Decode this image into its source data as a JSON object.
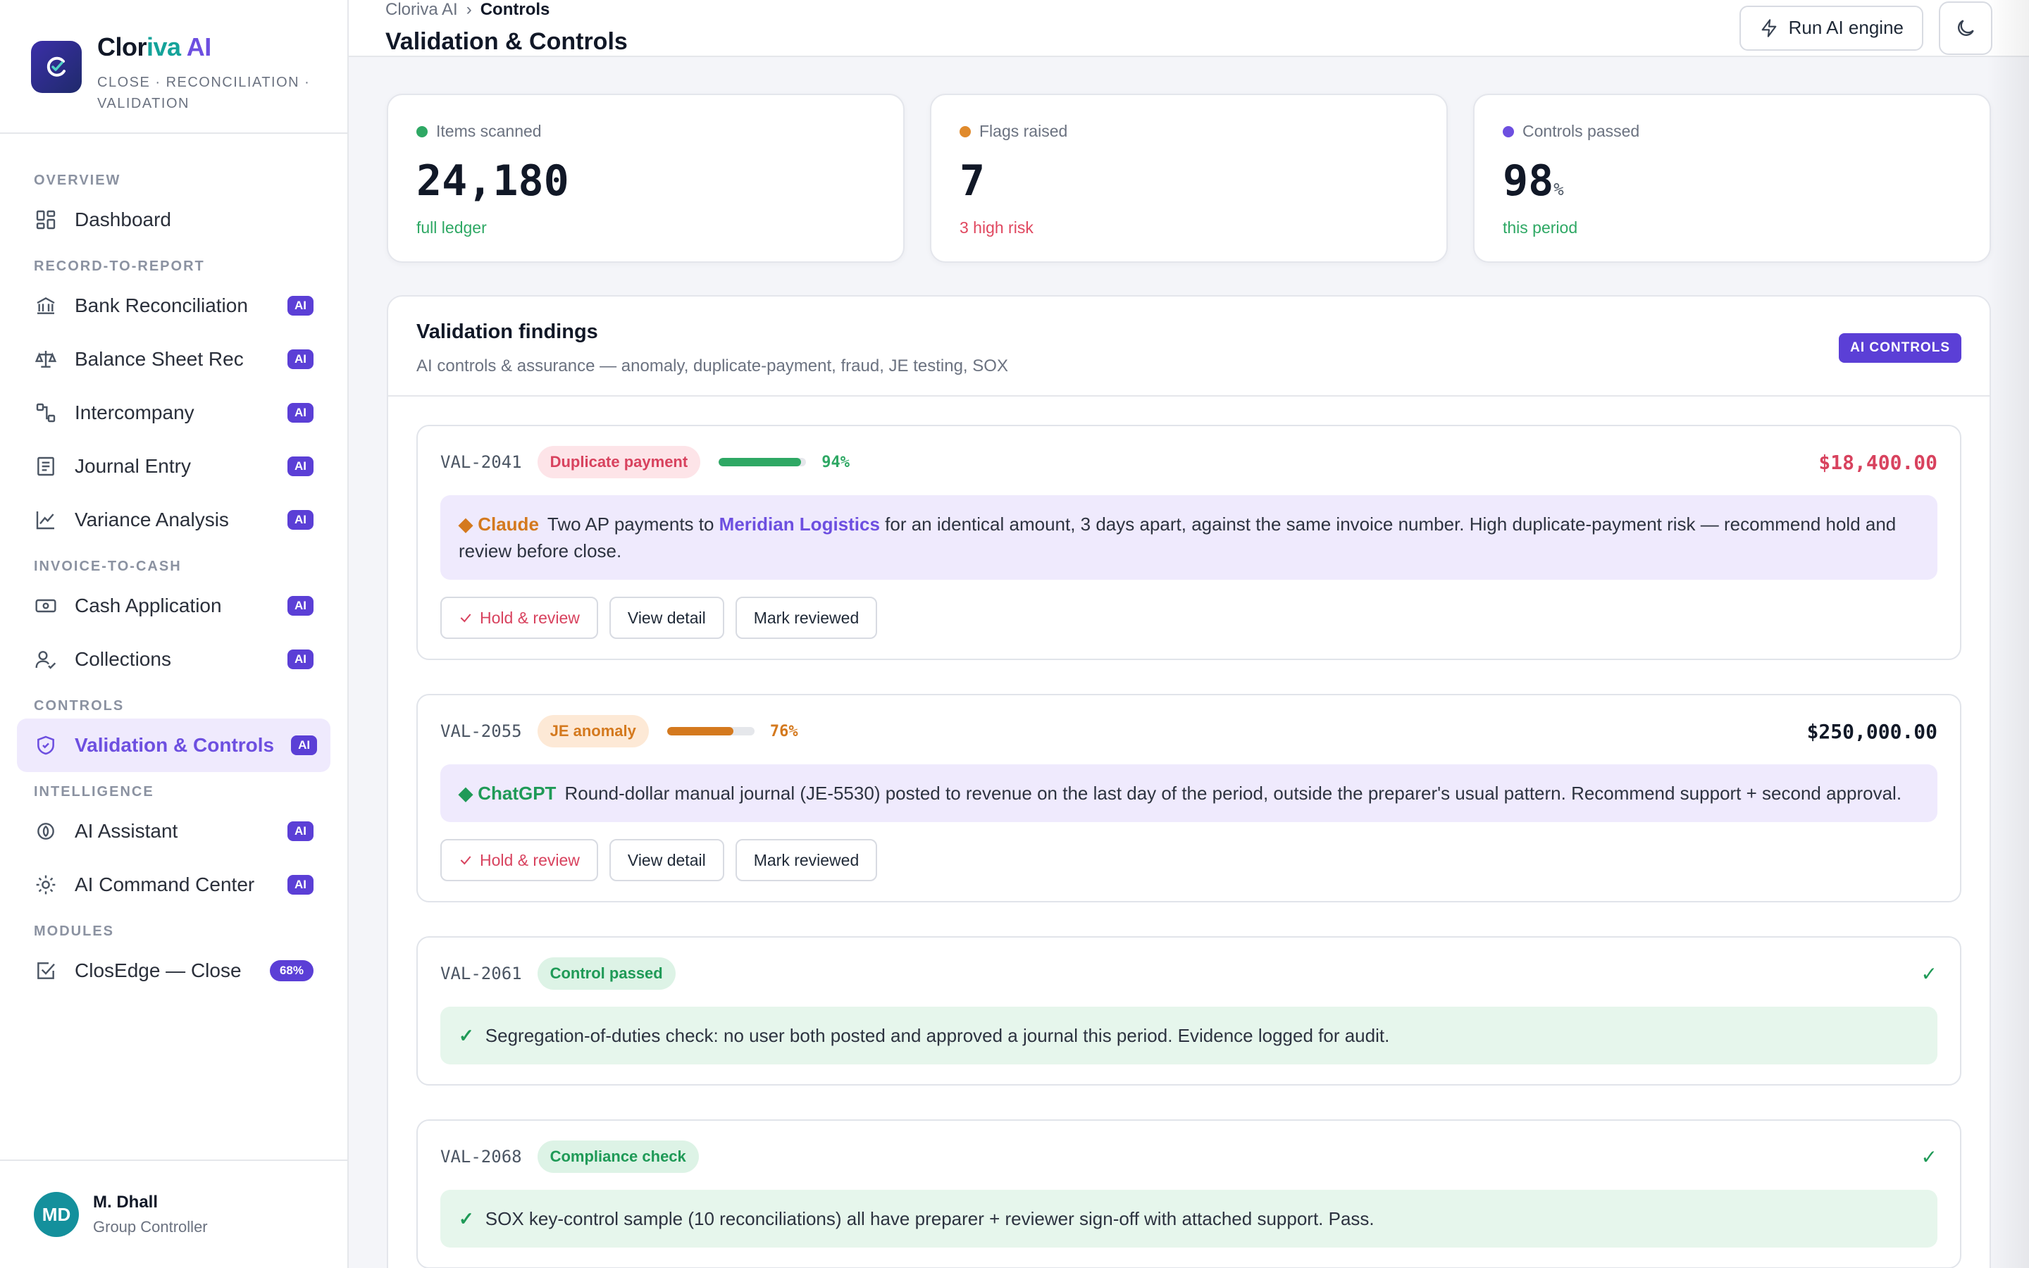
{
  "brand": {
    "name_part1": "Clor",
    "name_part2": "iva",
    "name_part3": " AI",
    "tagline": "CLOSE · RECONCILIATION · VALIDATION"
  },
  "nav": {
    "sections": {
      "overview": "OVERVIEW",
      "r2r": "RECORD-TO-REPORT",
      "i2c": "INVOICE-TO-CASH",
      "controls": "CONTROLS",
      "intelligence": "INTELLIGENCE",
      "modules": "MODULES"
    },
    "items": {
      "dashboard": "Dashboard",
      "bank_rec": "Bank Reconciliation",
      "bs_rec": "Balance Sheet Rec",
      "intercompany": "Intercompany",
      "journal": "Journal Entry",
      "variance": "Variance Analysis",
      "cash_app": "Cash Application",
      "collections": "Collections",
      "validation": "Validation & Controls",
      "assistant": "AI Assistant",
      "command": "AI Command Center",
      "closedge": "ClosEdge — Close"
    },
    "ai_badge": "AI",
    "closedge_progress": "68%"
  },
  "user": {
    "initials": "MD",
    "name": "M. Dhall",
    "role": "Group Controller"
  },
  "topbar": {
    "crumb_root": "Cloriva AI",
    "crumb_sep": "›",
    "crumb_current": "Controls",
    "title": "Validation & Controls",
    "run_label": "Run AI engine"
  },
  "stats": [
    {
      "label": "Items scanned",
      "value": "24,180",
      "unit": "",
      "sub": "full ledger",
      "dot": "#2ea864",
      "sub_color": "#2ea864"
    },
    {
      "label": "Flags raised",
      "value": "7",
      "unit": "",
      "sub": "3 high risk",
      "dot": "#e08a2c",
      "sub_color": "#e0475f"
    },
    {
      "label": "Controls passed",
      "value": "98",
      "unit": "%",
      "sub": "this period",
      "dot": "#6d4fe0",
      "sub_color": "#2ea864"
    }
  ],
  "panel": {
    "title": "Validation findings",
    "subtitle": "AI controls & assurance — anomaly, duplicate-payment, fraud, JE testing, SOX",
    "tag": "AI CONTROLS"
  },
  "findings": [
    {
      "id": "VAL-2041",
      "chip": "Duplicate payment",
      "confidence": 94,
      "confidence_label": "94%",
      "amount": "$18,400.00",
      "model": "◆ Claude",
      "text_before": "Two AP payments to ",
      "highlight": "Meridian Logistics",
      "text_after": " for an identical amount, 3 days apart, against the same invoice number. High duplicate-payment risk — recommend hold and review before close."
    },
    {
      "id": "VAL-2055",
      "chip": "JE anomaly",
      "confidence": 76,
      "confidence_label": "76%",
      "amount": "$250,000.00",
      "model": "◆ ChatGPT",
      "text": "Round-dollar manual journal (JE-5530) posted to revenue on the last day of the period, outside the preparer's usual pattern. Recommend support + second approval."
    },
    {
      "id": "VAL-2061",
      "chip": "Control passed",
      "status_icon": "✓",
      "text": "Segregation-of-duties check: no user both posted and approved a journal this period. Evidence logged for audit."
    },
    {
      "id": "VAL-2068",
      "chip": "Compliance check",
      "status_icon": "✓",
      "text": "SOX key-control sample (10 reconciliations) all have preparer + reviewer sign-off with attached support. Pass."
    }
  ],
  "actions": {
    "hold": "Hold & review",
    "view": "View detail",
    "mark": "Mark reviewed"
  },
  "colors": {
    "accent": "#6d4fe0",
    "ai_badge": "#5b3fd6",
    "risk_red": "#d8425e",
    "warn_orange": "#d4791e",
    "pass_green": "#1f9a57"
  }
}
